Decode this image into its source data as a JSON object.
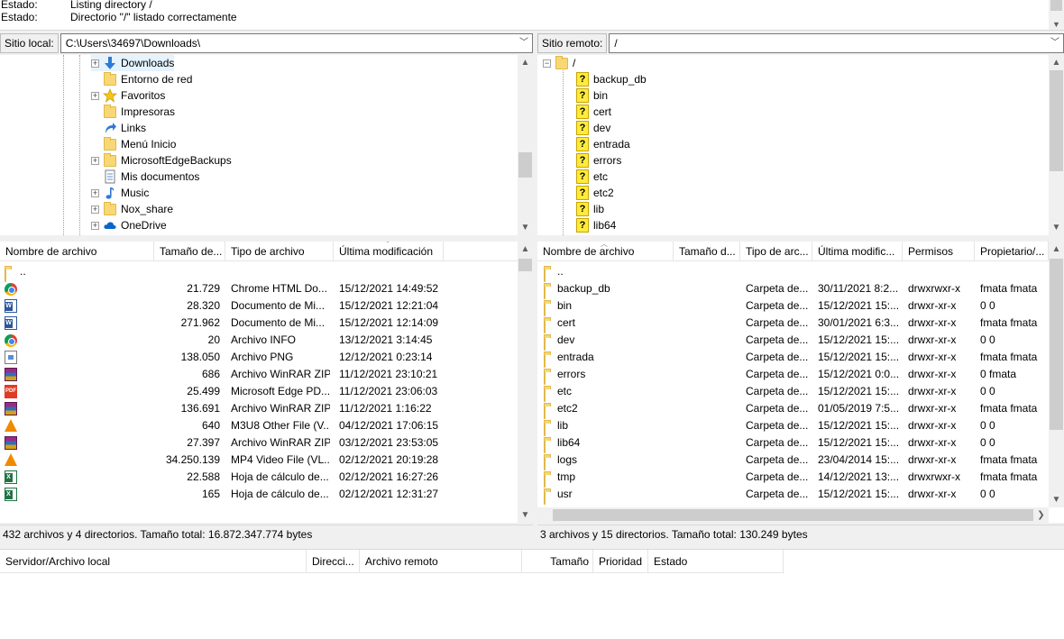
{
  "log": {
    "lines": [
      {
        "label": "Estado:",
        "text": "Listing directory /"
      },
      {
        "label": "Estado:",
        "text": "Directorio \"/\" listado correctamente"
      }
    ]
  },
  "local": {
    "site_label": "Sitio local:",
    "path": "C:\\Users\\34697\\Downloads\\",
    "tree": [
      {
        "name": "Downloads",
        "icon": "download-arrow-icon",
        "expander": "+"
      },
      {
        "name": "Entorno de red",
        "icon": "folder-icon",
        "expander": ""
      },
      {
        "name": "Favoritos",
        "icon": "star-icon",
        "expander": "+"
      },
      {
        "name": "Impresoras",
        "icon": "folder-icon",
        "expander": ""
      },
      {
        "name": "Links",
        "icon": "shortcut-arrow-icon",
        "expander": ""
      },
      {
        "name": "Menú Inicio",
        "icon": "folder-icon",
        "expander": ""
      },
      {
        "name": "MicrosoftEdgeBackups",
        "icon": "folder-icon",
        "expander": "+"
      },
      {
        "name": "Mis documentos",
        "icon": "document-icon",
        "expander": ""
      },
      {
        "name": "Music",
        "icon": "music-note-icon",
        "expander": "+"
      },
      {
        "name": "Nox_share",
        "icon": "folder-icon",
        "expander": "+"
      },
      {
        "name": "OneDrive",
        "icon": "cloud-icon",
        "expander": "+"
      }
    ],
    "columns": [
      "Nombre de archivo",
      "Tamaño de...",
      "Tipo de archivo",
      "Última modificación"
    ],
    "files": [
      {
        "name": "..",
        "size": "",
        "type": "",
        "modified": "",
        "icon": "folder"
      },
      {
        "name": "",
        "size": "21.729",
        "type": "Chrome HTML Do...",
        "modified": "15/12/2021 14:49:52",
        "icon": "chrome"
      },
      {
        "name": "",
        "size": "28.320",
        "type": "Documento de Mi...",
        "modified": "15/12/2021 12:21:04",
        "icon": "word"
      },
      {
        "name": "",
        "size": "271.962",
        "type": "Documento de Mi...",
        "modified": "15/12/2021 12:14:09",
        "icon": "word"
      },
      {
        "name": "",
        "size": "20",
        "type": "Archivo INFO",
        "modified": "13/12/2021 3:14:45",
        "icon": "chrome"
      },
      {
        "name": "",
        "size": "138.050",
        "type": "Archivo PNG",
        "modified": "12/12/2021 0:23:14",
        "icon": "png"
      },
      {
        "name": "",
        "size": "686",
        "type": "Archivo WinRAR ZIP",
        "modified": "11/12/2021 23:10:21",
        "icon": "rar"
      },
      {
        "name": "",
        "size": "25.499",
        "type": "Microsoft Edge PD...",
        "modified": "11/12/2021 23:06:03",
        "icon": "pdf"
      },
      {
        "name": "",
        "size": "136.691",
        "type": "Archivo WinRAR ZIP",
        "modified": "11/12/2021 1:16:22",
        "icon": "rar"
      },
      {
        "name": "",
        "size": "640",
        "type": "M3U8 Other File (V...",
        "modified": "04/12/2021 17:06:15",
        "icon": "vlc"
      },
      {
        "name": "",
        "size": "27.397",
        "type": "Archivo WinRAR ZIP",
        "modified": "03/12/2021 23:53:05",
        "icon": "rar"
      },
      {
        "name": "",
        "size": "34.250.139",
        "type": "MP4 Video File (VL...",
        "modified": "02/12/2021 20:19:28",
        "icon": "vlc"
      },
      {
        "name": "",
        "size": "22.588",
        "type": "Hoja de cálculo de...",
        "modified": "02/12/2021 16:27:26",
        "icon": "excel"
      },
      {
        "name": "",
        "size": "165",
        "type": "Hoja de cálculo de...",
        "modified": "02/12/2021 12:31:27",
        "icon": "excel"
      }
    ],
    "status": "432 archivos y 4 directorios. Tamaño total: 16.872.347.774 bytes"
  },
  "remote": {
    "site_label": "Sitio remoto:",
    "path": "/",
    "tree_root": "/",
    "tree": [
      "backup_db",
      "bin",
      "cert",
      "dev",
      "entrada",
      "errors",
      "etc",
      "etc2",
      "lib",
      "lib64"
    ],
    "unknown_glyph": "?",
    "columns": [
      "Nombre de archivo",
      "Tamaño d...",
      "Tipo de arc...",
      "Última modific...",
      "Permisos",
      "Propietario/..."
    ],
    "files": [
      {
        "name": "..",
        "type": "",
        "modified": "",
        "perms": "",
        "owner": ""
      },
      {
        "name": "backup_db",
        "type": "Carpeta de...",
        "modified": "30/11/2021 8:2...",
        "perms": "drwxrwxr-x",
        "owner": "fmata fmata"
      },
      {
        "name": "bin",
        "type": "Carpeta de...",
        "modified": "15/12/2021 15:...",
        "perms": "drwxr-xr-x",
        "owner": "0 0"
      },
      {
        "name": "cert",
        "type": "Carpeta de...",
        "modified": "30/01/2021 6:3...",
        "perms": "drwxr-xr-x",
        "owner": "fmata fmata"
      },
      {
        "name": "dev",
        "type": "Carpeta de...",
        "modified": "15/12/2021 15:...",
        "perms": "drwxr-xr-x",
        "owner": "0 0"
      },
      {
        "name": "entrada",
        "type": "Carpeta de...",
        "modified": "15/12/2021 15:...",
        "perms": "drwxr-xr-x",
        "owner": "fmata fmata"
      },
      {
        "name": "errors",
        "type": "Carpeta de...",
        "modified": "15/12/2021 0:0...",
        "perms": "drwxr-xr-x",
        "owner": "0 fmata"
      },
      {
        "name": "etc",
        "type": "Carpeta de...",
        "modified": "15/12/2021 15:...",
        "perms": "drwxr-xr-x",
        "owner": "0 0"
      },
      {
        "name": "etc2",
        "type": "Carpeta de...",
        "modified": "01/05/2019 7:5...",
        "perms": "drwxr-xr-x",
        "owner": "fmata fmata"
      },
      {
        "name": "lib",
        "type": "Carpeta de...",
        "modified": "15/12/2021 15:...",
        "perms": "drwxr-xr-x",
        "owner": "0 0"
      },
      {
        "name": "lib64",
        "type": "Carpeta de...",
        "modified": "15/12/2021 15:...",
        "perms": "drwxr-xr-x",
        "owner": "0 0"
      },
      {
        "name": "logs",
        "type": "Carpeta de...",
        "modified": "23/04/2014 15:...",
        "perms": "drwxr-xr-x",
        "owner": "fmata fmata"
      },
      {
        "name": "tmp",
        "type": "Carpeta de...",
        "modified": "14/12/2021 13:...",
        "perms": "drwxrwxr-x",
        "owner": "fmata fmata"
      },
      {
        "name": "usr",
        "type": "Carpeta de...",
        "modified": "15/12/2021 15:...",
        "perms": "drwxr-xr-x",
        "owner": "0 0"
      }
    ],
    "status": "3 archivos y 15 directorios. Tamaño total: 130.249 bytes"
  },
  "queue": {
    "columns": [
      "Servidor/Archivo local",
      "Direcci...",
      "Archivo remoto",
      "Tamaño",
      "Prioridad",
      "Estado"
    ]
  },
  "colors": {
    "folder": "#f8d775",
    "scroll_thumb": "#cdcdcd",
    "question_icon": "#ffeb3b"
  }
}
